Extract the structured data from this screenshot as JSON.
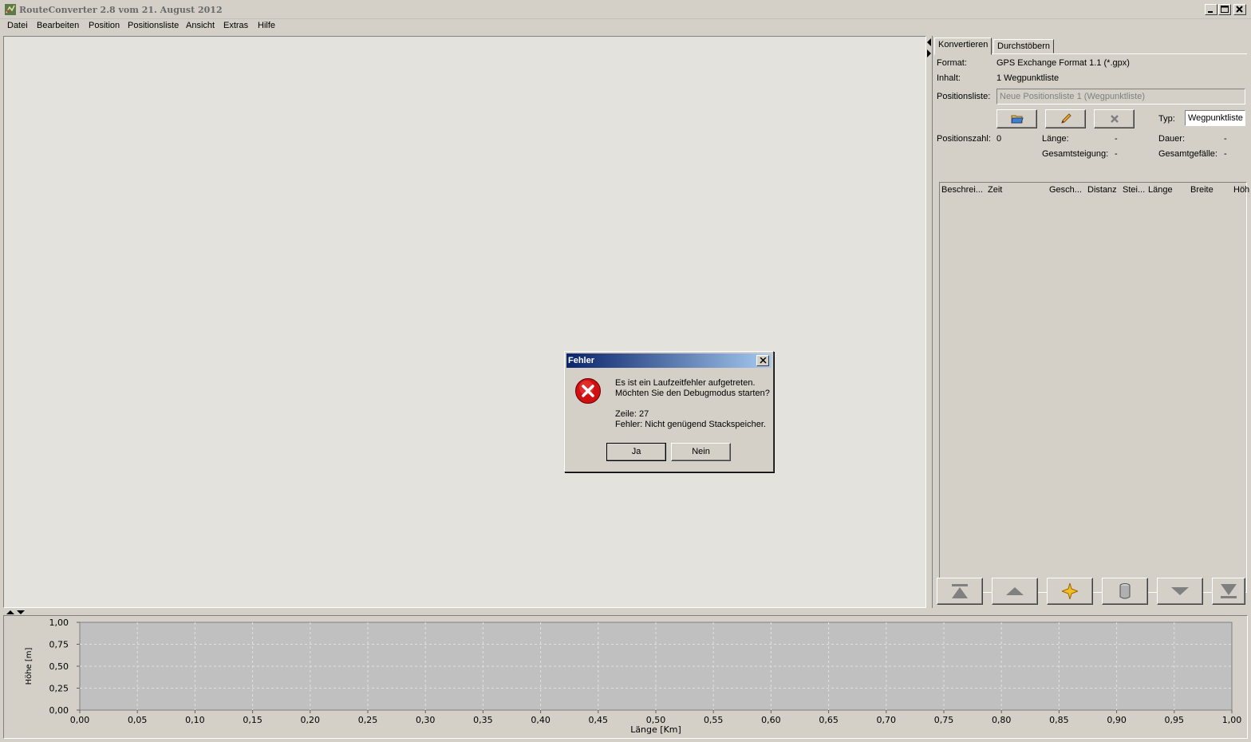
{
  "window": {
    "title": "RouteConverter 2.8 vom 21. August 2012",
    "icon": "route-converter-app-icon"
  },
  "menu": [
    "Datei",
    "Bearbeiten",
    "Position",
    "Positionsliste",
    "Ansicht",
    "Extras",
    "Hilfe"
  ],
  "panel": {
    "tabs": [
      "Konvertieren",
      "Durchstöbern"
    ],
    "format_label": "Format:",
    "format_value": "GPS Exchange Format 1.1 (*.gpx)",
    "inhalt_label": "Inhalt:",
    "inhalt_value": "1 Wegpunktliste",
    "positionsliste_label": "Positionsliste:",
    "positionsliste_value": "Neue Positionsliste 1 (Wegpunktliste)",
    "typ_label": "Typ:",
    "typ_value": "Wegpunktliste",
    "positionszahl_label": "Positionszahl:",
    "positionszahl_value": "0",
    "laenge_label": "Länge:",
    "laenge_value": "-",
    "dauer_label": "Dauer:",
    "dauer_value": "-",
    "gesamtsteigung_label": "Gesamtsteigung:",
    "gesamtsteigung_value": "-",
    "gesamtgefaelle_label": "Gesamtgefälle:",
    "gesamtgefaelle_value": "-",
    "columns": [
      "Beschrei...",
      "Zeit",
      "Gesch...",
      "Distanz",
      "Stei...",
      "Länge",
      "Breite",
      "Höh"
    ]
  },
  "chart_data": {
    "type": "line",
    "xlabel": "Länge [Km]",
    "ylabel": "Höhe [m]",
    "xlim": [
      0,
      1
    ],
    "ylim": [
      0,
      1
    ],
    "x_ticks": [
      "0,00",
      "0,05",
      "0,10",
      "0,15",
      "0,20",
      "0,25",
      "0,30",
      "0,35",
      "0,40",
      "0,45",
      "0,50",
      "0,55",
      "0,60",
      "0,65",
      "0,70",
      "0,75",
      "0,80",
      "0,85",
      "0,90",
      "0,95",
      "1,00"
    ],
    "y_ticks": [
      "0,00",
      "0,25",
      "0,50",
      "0,75",
      "1,00"
    ],
    "grid": true,
    "series": []
  },
  "dialog": {
    "title": "Fehler",
    "line1": "Es ist ein Laufzeitfehler aufgetreten.",
    "line2": "Möchten Sie den Debugmodus starten?",
    "line3": "Zeile: 27",
    "line4": "Fehler: Nicht genügend Stackspeicher.",
    "yes": "Ja",
    "no": "Nein"
  }
}
